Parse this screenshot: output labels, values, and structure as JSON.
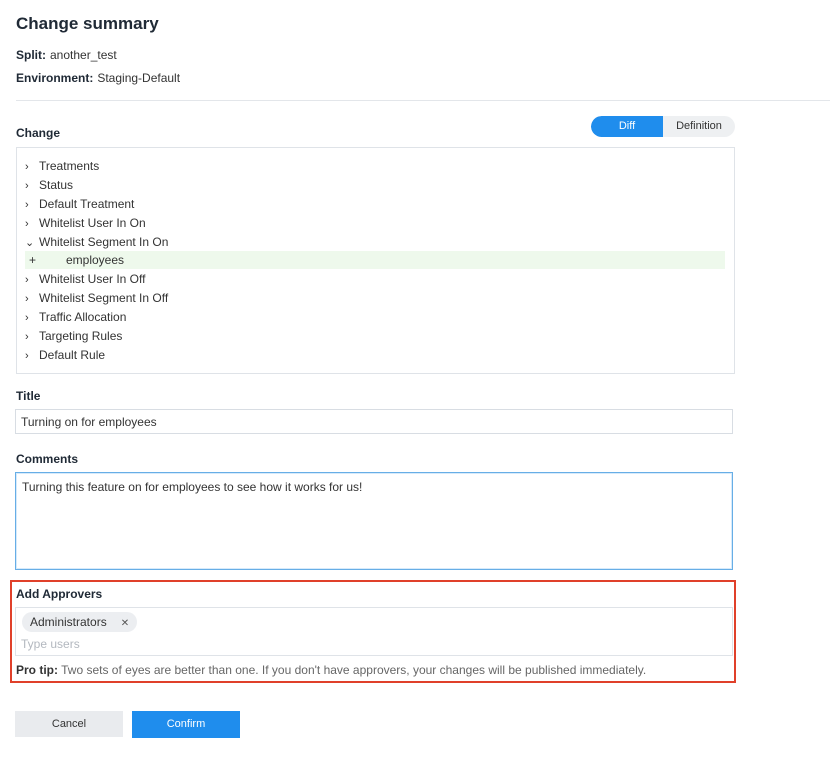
{
  "header": {
    "title": "Change summary",
    "split_label": "Split:",
    "split_value": "another_test",
    "env_label": "Environment:",
    "env_value": "Staging-Default"
  },
  "change": {
    "label": "Change",
    "view_toggle": {
      "diff": "Diff",
      "definition": "Definition",
      "selected": "Diff"
    },
    "tree": [
      {
        "label": "Treatments",
        "expanded": false
      },
      {
        "label": "Status",
        "expanded": false
      },
      {
        "label": "Default Treatment",
        "expanded": false
      },
      {
        "label": "Whitelist User In On",
        "expanded": false
      },
      {
        "label": "Whitelist Segment In On",
        "expanded": true,
        "added": {
          "marker": "+",
          "value": "employees"
        }
      },
      {
        "label": "Whitelist User In Off",
        "expanded": false
      },
      {
        "label": "Whitelist Segment In Off",
        "expanded": false
      },
      {
        "label": "Traffic Allocation",
        "expanded": false
      },
      {
        "label": "Targeting Rules",
        "expanded": false
      },
      {
        "label": "Default Rule",
        "expanded": false
      }
    ]
  },
  "form": {
    "title_label": "Title",
    "title_value": "Turning on for employees",
    "comments_label": "Comments",
    "comments_value": "Turning this feature on for employees to see how it works for us!"
  },
  "approvers": {
    "label": "Add Approvers",
    "chips": [
      "Administrators"
    ],
    "placeholder": "Type users",
    "protip_label": "Pro tip:",
    "protip_text": "Two sets of eyes are better than one. If you don't have approvers, your changes will be published immediately."
  },
  "actions": {
    "cancel": "Cancel",
    "confirm": "Confirm"
  },
  "colors": {
    "accent": "#1f8ded",
    "highlight_border": "#e0402a",
    "added_row_bg": "#eef9ec"
  }
}
